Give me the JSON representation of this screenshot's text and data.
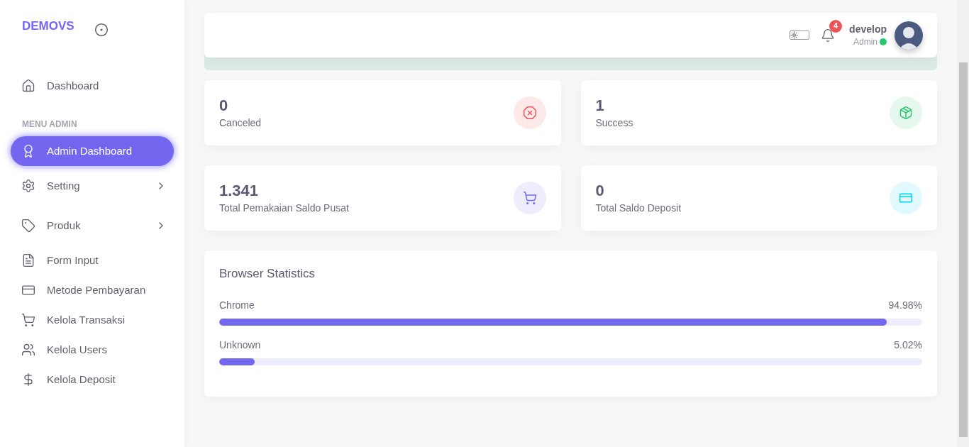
{
  "sidebar": {
    "brand": "DEMOVS",
    "items": [
      {
        "kind": "link",
        "label": "Dashboard",
        "selected": false
      },
      {
        "kind": "heading",
        "label": "MENU ADMIN"
      },
      {
        "kind": "link",
        "label": "Admin Dashboard",
        "selected": true
      },
      {
        "kind": "group",
        "label": "Setting",
        "selected": false
      },
      {
        "kind": "group",
        "label": "Produk",
        "selected": false
      },
      {
        "kind": "link",
        "label": "Form Input",
        "selected": false
      },
      {
        "kind": "link",
        "label": "Metode Pembayaran",
        "selected": false
      },
      {
        "kind": "link",
        "label": "Kelola Transaksi",
        "selected": false
      },
      {
        "kind": "link",
        "label": "Kelola Users",
        "selected": false
      },
      {
        "kind": "link",
        "label": "Kelola Deposit",
        "selected": false
      }
    ]
  },
  "header": {
    "notifications": "4",
    "user": "develop",
    "role": "Admin",
    "dark_mode": false
  },
  "stats": [
    {
      "value": "0",
      "label": "Canceled",
      "color": "#ea5455"
    },
    {
      "value": "1",
      "label": "Success",
      "color": "#28c76f"
    },
    {
      "value": "1.341",
      "label": "Total Pemakaian Saldo Pusat",
      "color": "#7367f0"
    },
    {
      "value": "0",
      "label": "Total Saldo Deposit",
      "color": "#00cfe8"
    }
  ],
  "browser_stats": {
    "title": "Browser Statistics",
    "rows": [
      {
        "name": "Chrome",
        "reading": "94.98%",
        "level": 0.9498
      },
      {
        "name": "Unknown",
        "reading": "5.02%",
        "level": 0.0502
      }
    ]
  }
}
